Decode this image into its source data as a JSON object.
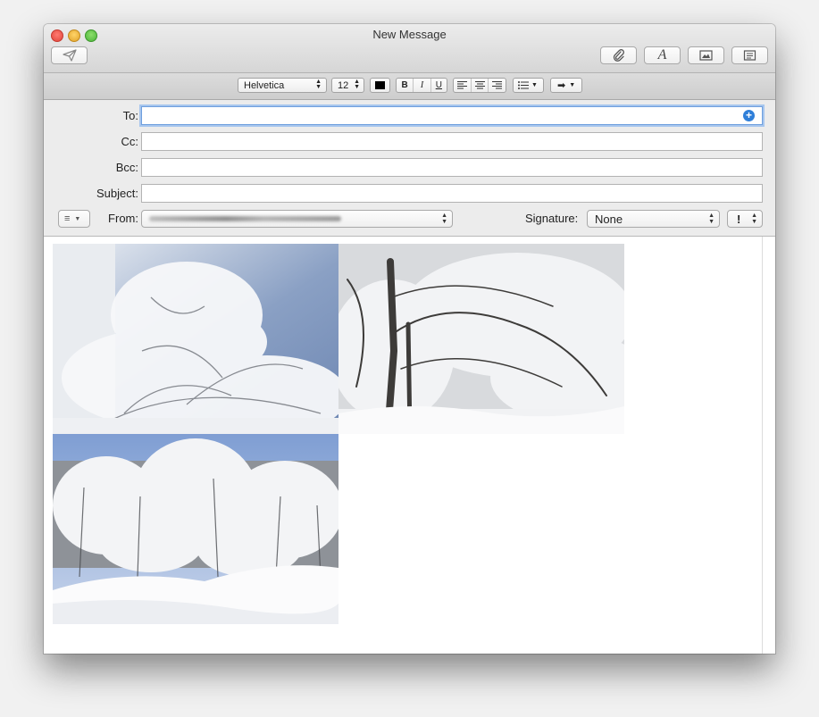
{
  "window": {
    "title": "New Message"
  },
  "toolbar": {
    "send_icon": "paper-plane-icon",
    "attach_icon": "paperclip-icon",
    "fonts_icon": "font-a-icon",
    "photo_icon": "photo-browser-icon",
    "template_icon": "stationery-icon"
  },
  "format": {
    "font": "Helvetica",
    "size": "12",
    "bold": "B",
    "italic": "I",
    "underline": "U",
    "text_color": "#000000"
  },
  "headers": {
    "to_label": "To:",
    "cc_label": "Cc:",
    "bcc_label": "Bcc:",
    "subject_label": "Subject:",
    "from_label": "From:",
    "signature_label": "Signature:",
    "signature_value": "None",
    "to_value": "",
    "cc_value": "",
    "bcc_value": "",
    "subject_value": "",
    "priority": "!"
  },
  "body": {
    "attachments": [
      {
        "name": "snow-photo-1",
        "description": ""
      },
      {
        "name": "snow-photo-2",
        "description": ""
      },
      {
        "name": "snow-photo-3",
        "description": ""
      }
    ]
  },
  "colors": {
    "focus_ring": "#6e9fde",
    "add_contact": "#2f7fd9"
  }
}
